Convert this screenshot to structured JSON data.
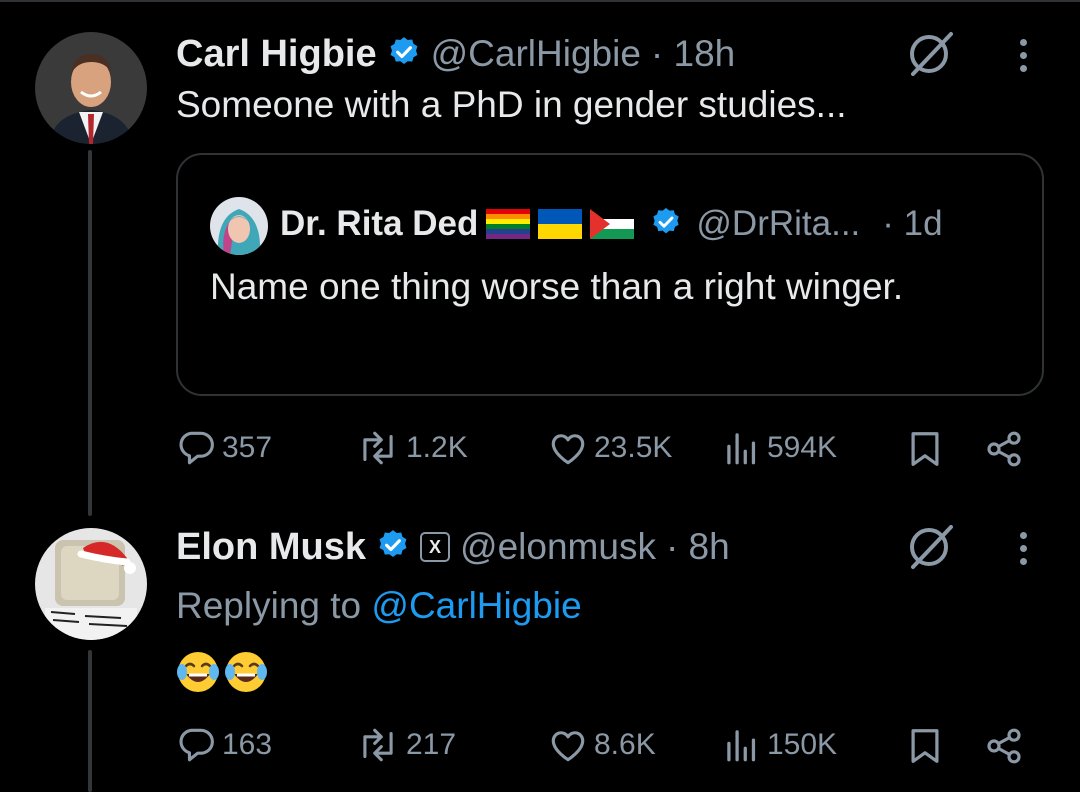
{
  "tweet1": {
    "name": "Carl Higbie",
    "handle": "@CarlHigbie",
    "time": "· 18h",
    "text": "Someone with a PhD in gender studies...",
    "quote": {
      "name": "Dr. Rita Ded",
      "handle": "@DrRita...",
      "time": "· 1d",
      "text": "Name one thing worse than a right winger."
    },
    "stats": {
      "replies": "357",
      "reposts": "1.2K",
      "likes": "23.5K",
      "views": "594K"
    }
  },
  "tweet2": {
    "name": "Elon Musk",
    "affiliate_badge": "X",
    "handle": "@elonmusk",
    "time": "· 8h",
    "replying_prefix": "Replying to",
    "replying_handle": "@CarlHigbie",
    "stats": {
      "replies": "163",
      "reposts": "217",
      "likes": "8.6K",
      "views": "150K"
    }
  },
  "colors": {
    "accent": "#1d9bf0",
    "muted": "#8b98a5",
    "background": "#000000",
    "text": "#e7e9ea"
  },
  "icons": [
    "grok-icon",
    "more-icon",
    "reply-icon",
    "repost-icon",
    "like-icon",
    "views-icon",
    "bookmark-icon",
    "share-icon",
    "verified-icon",
    "flag-rainbow-icon",
    "flag-ukraine-icon",
    "flag-palestine-icon",
    "laughing-emoji-icon"
  ]
}
